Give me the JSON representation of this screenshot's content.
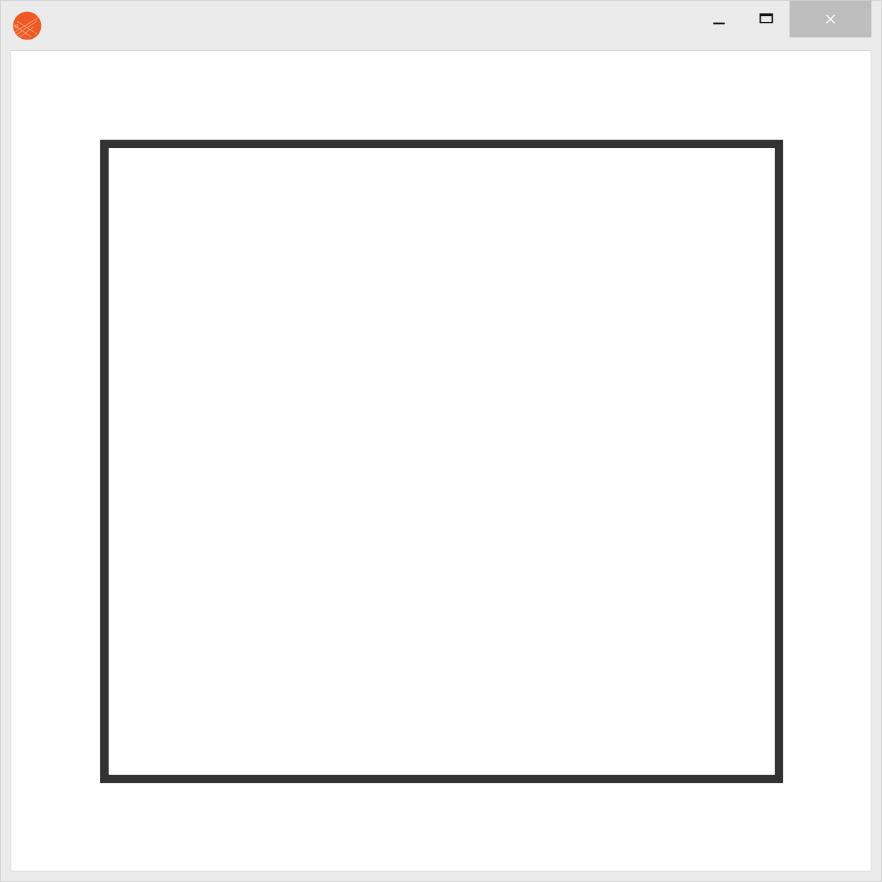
{
  "window": {
    "icon": "app-logo-icon",
    "controls": [
      {
        "name": "minimize-button",
        "icon": "minimize-icon"
      },
      {
        "name": "maximize-button",
        "icon": "maximize-icon"
      },
      {
        "name": "close-button",
        "icon": "close-icon"
      }
    ]
  },
  "colors": {
    "logo": "#ee5a24",
    "frame": "#ebebeb",
    "close_hover": "#bdbdbd",
    "box_border": "#333333"
  }
}
